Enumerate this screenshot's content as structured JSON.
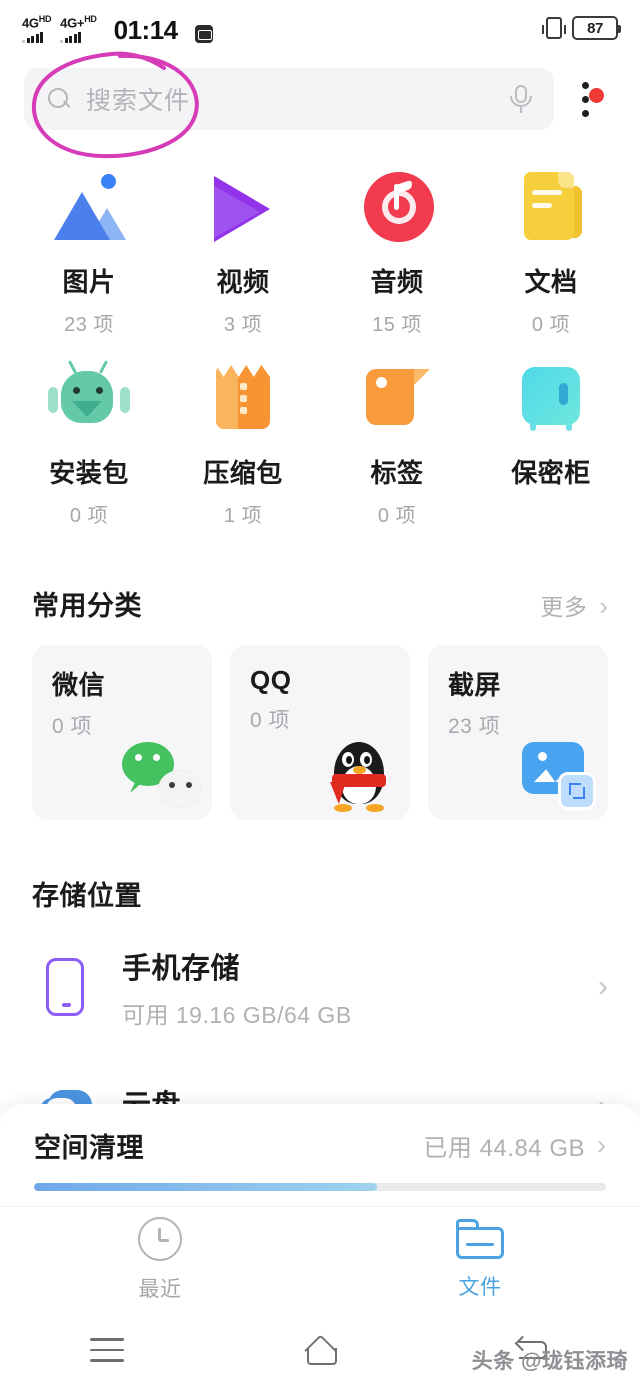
{
  "status_bar": {
    "sim1_network": "4G",
    "sim1_hd": "HD",
    "sim2_network": "4G+",
    "sim2_hd": "HD",
    "time": "01:14",
    "message_icon": "message-icon",
    "vibrate_icon": "vibrate-icon",
    "battery_percent": "87"
  },
  "search": {
    "placeholder": "搜索文件",
    "search_icon": "search-icon",
    "mic_icon": "microphone-icon",
    "menu_icon": "overflow-menu-icon",
    "badge_color": "#ef3b36",
    "annotation_color": "#d63bb8"
  },
  "categories": [
    {
      "label": "图片",
      "count": "23 项",
      "icon": "image-icon"
    },
    {
      "label": "视频",
      "count": "3 项",
      "icon": "video-icon"
    },
    {
      "label": "音频",
      "count": "15 项",
      "icon": "audio-icon"
    },
    {
      "label": "文档",
      "count": "0 项",
      "icon": "document-icon"
    },
    {
      "label": "安装包",
      "count": "0 项",
      "icon": "apk-icon"
    },
    {
      "label": "压缩包",
      "count": "1 项",
      "icon": "archive-icon"
    },
    {
      "label": "标签",
      "count": "0 项",
      "icon": "tag-icon"
    },
    {
      "label": "保密柜",
      "count": "",
      "icon": "vault-icon"
    }
  ],
  "common_section": {
    "title": "常用分类",
    "more_label": "更多",
    "more_arrow": "›",
    "cards": [
      {
        "title": "微信",
        "count": "0 项",
        "icon": "wechat-icon"
      },
      {
        "title": "QQ",
        "count": "0 项",
        "icon": "qq-icon"
      },
      {
        "title": "截屏",
        "count": "23 项",
        "icon": "screenshot-icon"
      }
    ]
  },
  "storage_section": {
    "title": "存储位置",
    "rows": [
      {
        "name": "手机存储",
        "sub": "可用 19.16 GB/64 GB",
        "icon": "phone-icon",
        "arrow": "›"
      },
      {
        "name": "云盘",
        "sub": "",
        "icon": "cloud-icon",
        "arrow": "›"
      }
    ]
  },
  "cleanup_panel": {
    "title": "空间清理",
    "used_label": "已用 44.84 GB",
    "arrow": "›",
    "progress_percent": 60,
    "bar_color": "#6ea8ea"
  },
  "bottom_tabs": [
    {
      "label": "最近",
      "icon": "clock-icon",
      "active": false
    },
    {
      "label": "文件",
      "icon": "folder-icon",
      "active": true
    }
  ],
  "nav_bar": {
    "menu_icon": "menu-icon",
    "home_icon": "home-icon",
    "back_icon": "back-icon"
  },
  "watermark": "头条 @珑钰添琦"
}
